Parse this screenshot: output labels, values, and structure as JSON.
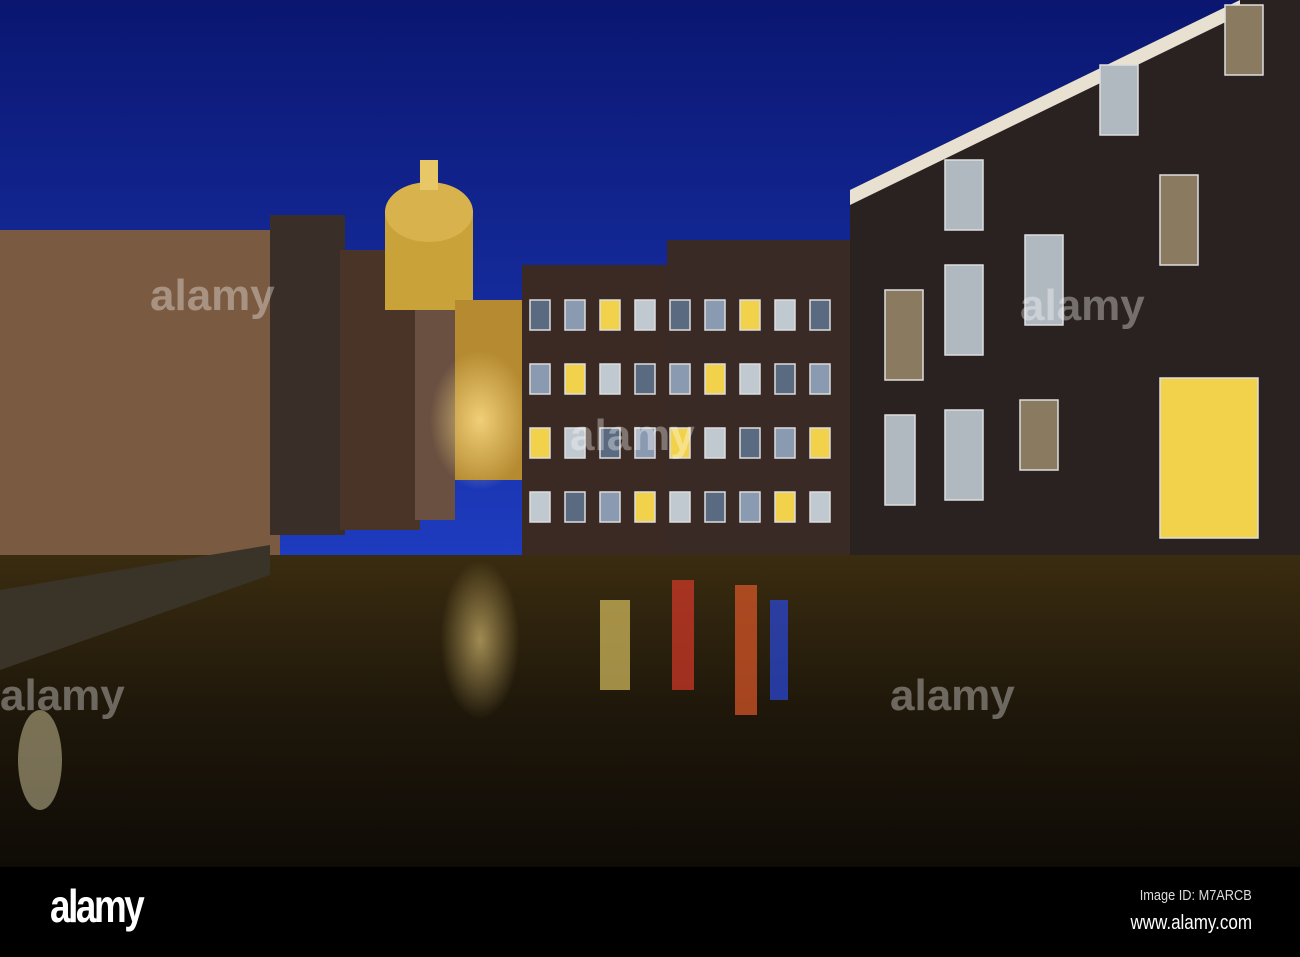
{
  "photo": {
    "subject": "Amsterdam canal at night with St. Nicholas Basilica",
    "colors": {
      "sky_top": "#0a1670",
      "sky_bottom": "#1e3cc0",
      "water": "#1a1408",
      "brick": "#2a2220",
      "window_warm": "#f2d24a"
    }
  },
  "footer": {
    "logo": "alamy",
    "image_id": "Image ID: M7ARCB",
    "url": "www.alamy.com"
  }
}
